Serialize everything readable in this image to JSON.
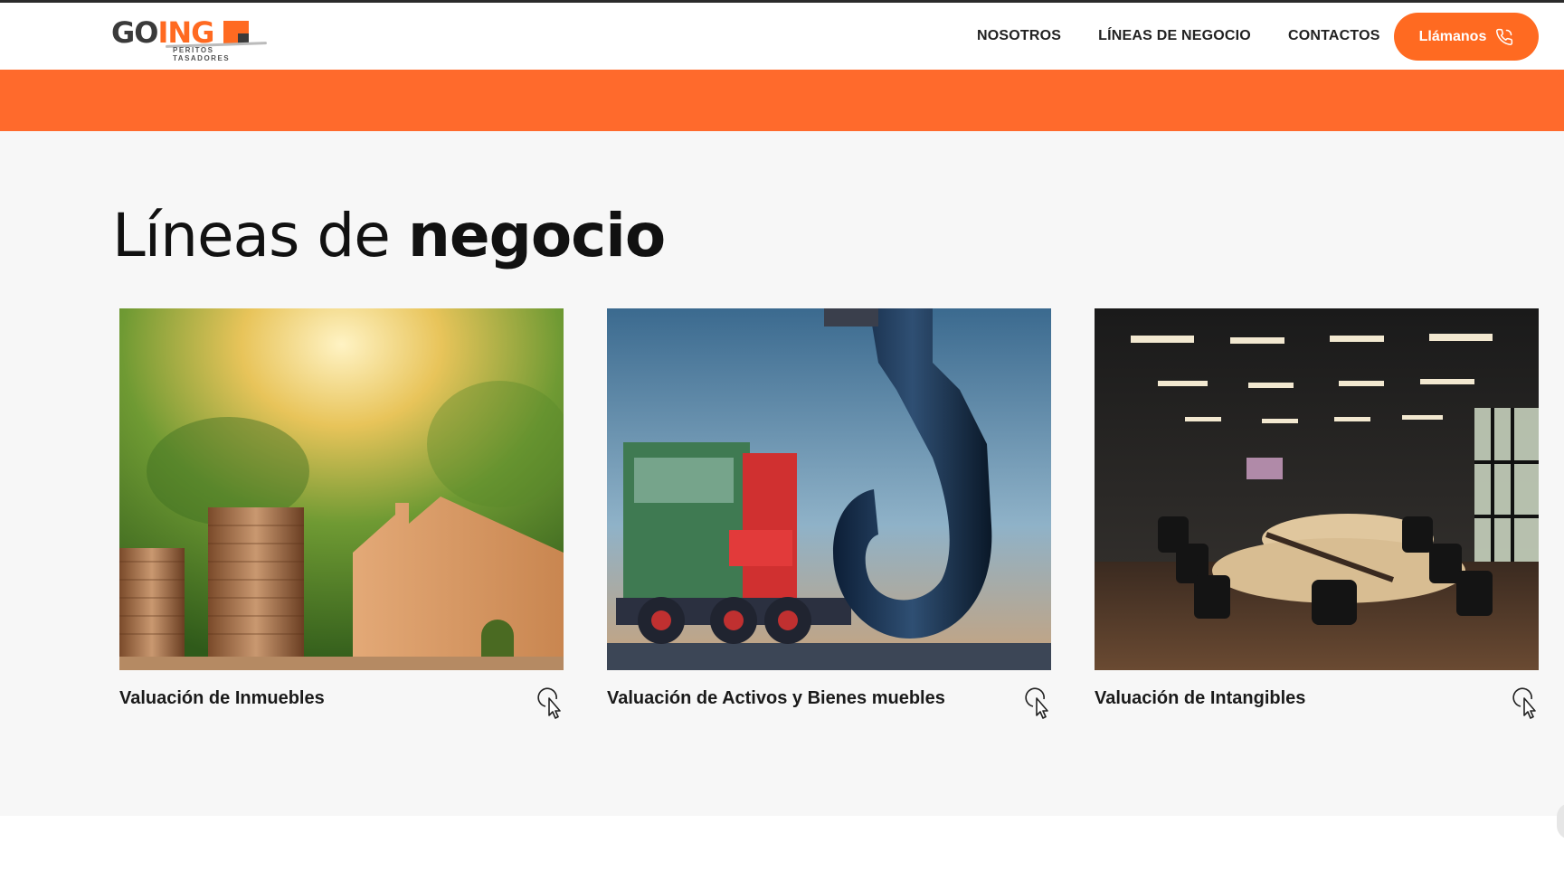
{
  "logo": {
    "brand_left": "GO",
    "brand_right": "ING",
    "tagline": "PERITOS TASADORES"
  },
  "nav": {
    "items": [
      {
        "label": "NOSOTROS"
      },
      {
        "label": "LÍNEAS DE NEGOCIO"
      },
      {
        "label": "CONTACTOS"
      }
    ],
    "call_label": "Llámanos"
  },
  "colors": {
    "accent": "#ff6a21",
    "banner": "#ff6a2c",
    "section_bg": "#f7f7f7"
  },
  "section": {
    "title_light": "Líneas de",
    "title_bold": "negocio",
    "cards": [
      {
        "title": "Valuación de Inmuebles",
        "image": "coins-and-wooden-house",
        "icon": "pointer-click-icon"
      },
      {
        "title": "Valuación de Activos y Bienes muebles",
        "image": "truck-and-crane-hook",
        "icon": "pointer-click-icon"
      },
      {
        "title": "Valuación de Intangibles",
        "image": "conference-room",
        "icon": "pointer-click-icon"
      }
    ]
  }
}
